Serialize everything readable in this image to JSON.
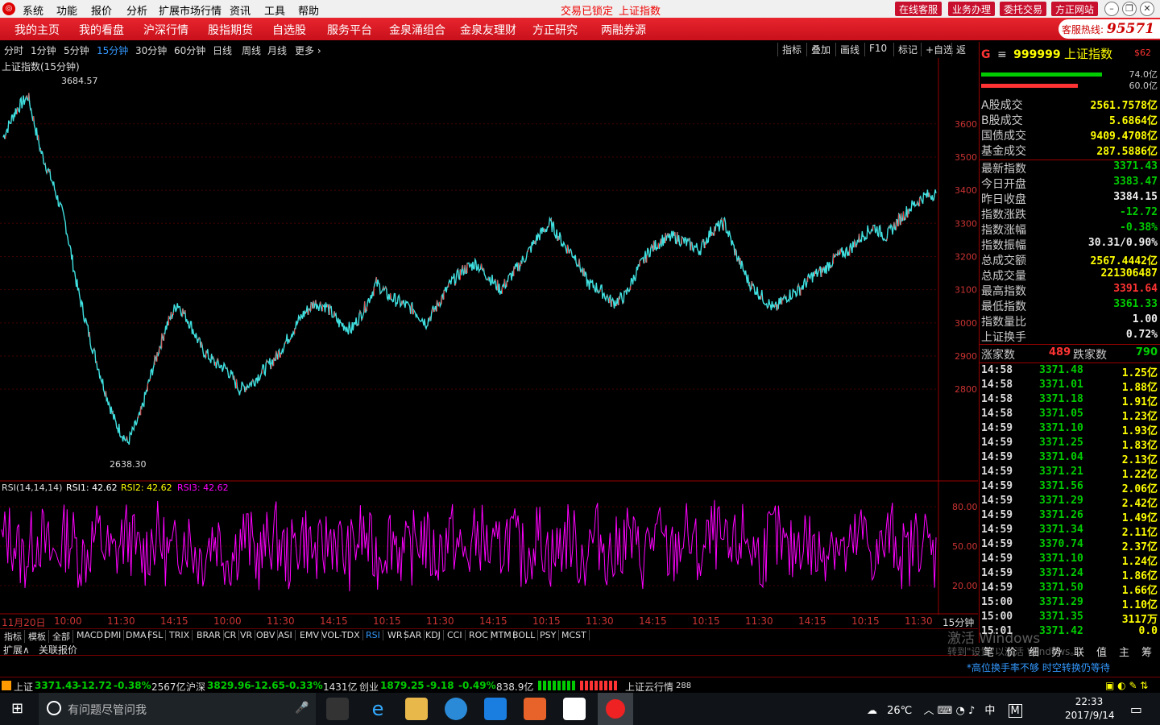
{
  "menubar": {
    "items": [
      "系统",
      "功能",
      "报价",
      "分析",
      "扩展市场行情",
      "资讯",
      "工具",
      "帮助"
    ],
    "center_status": "交易已锁定",
    "center_title": "上证指数",
    "buttons": [
      "在线客服",
      "业务办理",
      "委托交易",
      "方正网站"
    ]
  },
  "navbar": {
    "items": [
      "我的主页",
      "我的看盘",
      "沪深行情",
      "股指期货",
      "自选股",
      "服务平台",
      "金泉涌组合",
      "金泉友理财",
      "方正研究",
      "两融券源"
    ],
    "hotline_label": "客服热线:",
    "hotline_number": "95571"
  },
  "periods": {
    "items": [
      "分时",
      "1分钟",
      "5分钟",
      "15分钟",
      "30分钟",
      "60分钟",
      "日线",
      "周线",
      "月线",
      "更多 ›"
    ],
    "selected": "15分钟",
    "tools": [
      "指标",
      "叠加",
      "画线",
      "F10",
      "标记",
      "+自选",
      "返回"
    ]
  },
  "chart": {
    "title": "上证指数(15分钟)",
    "high_label": "3684.57",
    "low_label": "2638.30",
    "y_ticks": [
      "3600",
      "3500",
      "3400",
      "3300",
      "3200",
      "3100",
      "3000",
      "2900",
      "2800"
    ],
    "rsi_title": "RSI(14,14,14)",
    "rsi1_label": "RSI1: 42.62",
    "rsi2_label": "RSI2: 42.62",
    "rsi3_label": "RSI3: 42.62",
    "rsi_ticks": [
      "80.00",
      "50.00",
      "20.00"
    ],
    "x_labels": [
      "11月20日",
      "10:00",
      "11:30",
      "14:15",
      "10:00",
      "11:30",
      "14:15",
      "10:15",
      "11:30",
      "14:15",
      "10:15",
      "11:30",
      "14:15",
      "10:15",
      "11:30",
      "14:15",
      "10:15",
      "11:30"
    ],
    "period_label": "15分钟",
    "colors": {
      "up": "#ff3030",
      "down": "#40e0e0",
      "rsi": "#ff00ff"
    }
  },
  "chart_data": {
    "type": "line",
    "title": "上证指数(15分钟)",
    "series": [
      {
        "values": [
          3560,
          3640,
          3684,
          3520,
          3420,
          3300,
          3100,
          2950,
          2820,
          2700,
          2638,
          2720,
          2860,
          2980,
          3060,
          3000,
          2920,
          2880,
          2860,
          2800,
          2820,
          2860,
          2900,
          2960,
          3020,
          3060,
          3050,
          3000,
          2980,
          3040,
          3120,
          3080,
          3060,
          3040,
          3000,
          3060,
          3120,
          3160,
          3180,
          3140,
          3100,
          3150,
          3200,
          3260,
          3300,
          3240,
          3200,
          3120,
          3100,
          3060,
          3080,
          3160,
          3220,
          3250,
          3260,
          3240,
          3220,
          3280,
          3300,
          3200,
          3120,
          3080,
          3040,
          3080,
          3100,
          3140,
          3160,
          3200,
          3220,
          3260,
          3290,
          3260,
          3310,
          3350,
          3380,
          3391
        ]
      }
    ],
    "ylim": [
      2600,
      3800
    ],
    "yticks": [
      3600,
      3500,
      3400,
      3300,
      3200,
      3100,
      3000,
      2900,
      2800
    ]
  },
  "rpanel": {
    "code": "999999",
    "name": "上证指数",
    "ratio_top": "74.0亿",
    "ratio_bottom": "60.0亿",
    "turnover": [
      {
        "label": "A股成交",
        "value": "2561.7578亿"
      },
      {
        "label": "B股成交",
        "value": "5.6864亿"
      },
      {
        "label": "国债成交",
        "value": "9409.4708亿"
      },
      {
        "label": "基金成交",
        "value": "287.5886亿"
      }
    ],
    "stats": [
      {
        "label": "最新指数",
        "value": "3371.43",
        "color": "dn"
      },
      {
        "label": "今日开盘",
        "value": "3383.47",
        "color": "dn"
      },
      {
        "label": "昨日收盘",
        "value": "3384.15",
        "color": "wt"
      },
      {
        "label": "指数涨跌",
        "value": "-12.72",
        "color": "dn"
      },
      {
        "label": "指数涨幅",
        "value": "-0.38%",
        "color": "dn"
      },
      {
        "label": "指数振幅",
        "value": "30.31/0.90%",
        "color": "wt"
      },
      {
        "label": "总成交额",
        "value": "2567.4442亿",
        "color": "yl"
      },
      {
        "label": "总成交量",
        "value": "221306487",
        "color": "yl"
      },
      {
        "label": "最高指数",
        "value": "3391.64",
        "color": "up"
      },
      {
        "label": "最低指数",
        "value": "3361.33",
        "color": "dn"
      },
      {
        "label": "指数量比",
        "value": "1.00",
        "color": "wt"
      },
      {
        "label": "上证换手",
        "value": "0.72%",
        "color": "wt"
      }
    ],
    "adv_label": "涨家数",
    "adv_value": "489",
    "dec_label": "跌家数",
    "dec_value": "790",
    "ticks": [
      {
        "t": "14:58",
        "p": "3371.48",
        "v": "1.25亿"
      },
      {
        "t": "14:58",
        "p": "3371.01",
        "v": "1.88亿"
      },
      {
        "t": "14:58",
        "p": "3371.18",
        "v": "1.91亿"
      },
      {
        "t": "14:58",
        "p": "3371.05",
        "v": "1.23亿"
      },
      {
        "t": "14:59",
        "p": "3371.10",
        "v": "1.93亿"
      },
      {
        "t": "14:59",
        "p": "3371.25",
        "v": "1.83亿"
      },
      {
        "t": "14:59",
        "p": "3371.04",
        "v": "2.13亿"
      },
      {
        "t": "14:59",
        "p": "3371.21",
        "v": "1.22亿"
      },
      {
        "t": "14:59",
        "p": "3371.56",
        "v": "2.06亿"
      },
      {
        "t": "14:59",
        "p": "3371.29",
        "v": "2.42亿"
      },
      {
        "t": "14:59",
        "p": "3371.26",
        "v": "1.49亿"
      },
      {
        "t": "14:59",
        "p": "3371.34",
        "v": "2.11亿"
      },
      {
        "t": "14:59",
        "p": "3370.74",
        "v": "2.37亿"
      },
      {
        "t": "14:59",
        "p": "3371.10",
        "v": "1.24亿"
      },
      {
        "t": "14:59",
        "p": "3371.24",
        "v": "1.86亿"
      },
      {
        "t": "14:59",
        "p": "3371.50",
        "v": "1.66亿"
      },
      {
        "t": "15:00",
        "p": "3371.29",
        "v": "1.10亿"
      },
      {
        "t": "15:00",
        "p": "3371.35",
        "v": "3117万"
      },
      {
        "t": "15:01",
        "p": "3371.42",
        "v": "0.0"
      }
    ],
    "bottom_tabs": [
      "笔",
      "价",
      "细",
      "势",
      "联",
      "值",
      "主",
      "筹"
    ]
  },
  "indicator_tabs": [
    "指标",
    "模板",
    "全部",
    "MACD",
    "DMI",
    "DMA",
    "FSL",
    "TRIX",
    "BRAR",
    "CR",
    "VR",
    "OBV",
    "ASI",
    "EMV",
    "VOL-TDX",
    "RSI",
    "WR",
    "SAR",
    "KDJ",
    "CCI",
    "ROC",
    "MTM",
    "BOLL",
    "PSY",
    "MCST"
  ],
  "indicator_selected": "RSI",
  "sub_tabs": [
    "扩展∧",
    "关联报价"
  ],
  "notice": "*高位换手率不够 时空转换仍等待",
  "watermark1": "激活 Windows",
  "watermark2": "转到\"设置\"以激活 Windows。",
  "statusbar": {
    "sh_label": "上证",
    "sh_val": "3371.43",
    "sh_chg": "-12.72",
    "sh_pct": "-0.38%",
    "sh_amt": "2567亿",
    "hs_label": "沪深",
    "hs_val": "3829.96",
    "hs_chg": "-12.65",
    "hs_pct": "-0.33%",
    "hs_amt": "1431亿",
    "cy_label": "创业",
    "cy_val": "1879.25",
    "cy_chg": "-9.18",
    "cy_pct": "-0.49%",
    "cy_amt": "838.9亿",
    "cloud": "上证云行情",
    "cloud_num": "288"
  },
  "taskbar": {
    "search_placeholder": "有问题尽管问我",
    "temperature": "26℃",
    "ime": "中",
    "time": "22:33",
    "date": "2017/9/14"
  }
}
